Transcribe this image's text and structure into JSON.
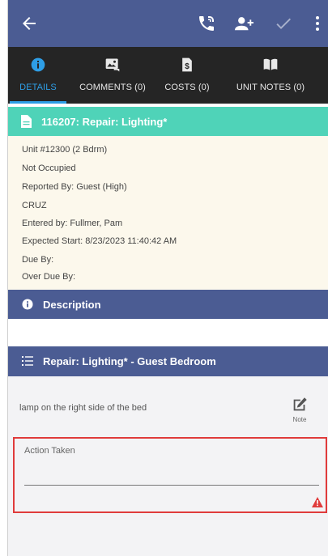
{
  "appbar": {
    "back_icon": "arrow-left-icon",
    "call_icon": "phone-call-icon",
    "assign_icon": "person-add-icon",
    "complete_icon": "check-icon",
    "menu_icon": "more-vertical-icon"
  },
  "tabs": [
    {
      "label": "DETAILS",
      "icon": "info-circle-icon",
      "active": true
    },
    {
      "label": "COMMENTS (0)",
      "icon": "photo-comment-icon",
      "active": false
    },
    {
      "label": "COSTS (0)",
      "icon": "dollar-doc-icon",
      "active": false
    },
    {
      "label": "UNIT NOTES (0)",
      "icon": "book-icon",
      "active": false
    }
  ],
  "work_order": {
    "title": "116207: Repair: Lighting*",
    "icon": "document-icon"
  },
  "info_lines": [
    "Unit #12300 (2 Bdrm)",
    "Not Occupied",
    "Reported By: Guest  (High)",
    "CRUZ",
    "Entered by: Fullmer, Pam",
    "Expected Start: 8/23/2023 11:40:42 AM",
    "Due By:",
    "Over Due By:"
  ],
  "description": {
    "title": "Description",
    "icon": "info-circle-icon"
  },
  "task": {
    "title": "Repair: Lighting* - Guest Bedroom",
    "icon": "checklist-icon",
    "note_text": "lamp on the right side of the bed",
    "note_button_label": "Note",
    "note_icon": "edit-icon"
  },
  "action_taken": {
    "label": "Action Taken",
    "value": "",
    "warning_icon": "warning-icon"
  },
  "colors": {
    "appbar": "#4b5c93",
    "tabbar": "#252525",
    "tab_active": "#2e9ee6",
    "work_order_header": "#4fd3b8",
    "info_background": "#fcf8ec",
    "error_border": "#e03b3b"
  }
}
